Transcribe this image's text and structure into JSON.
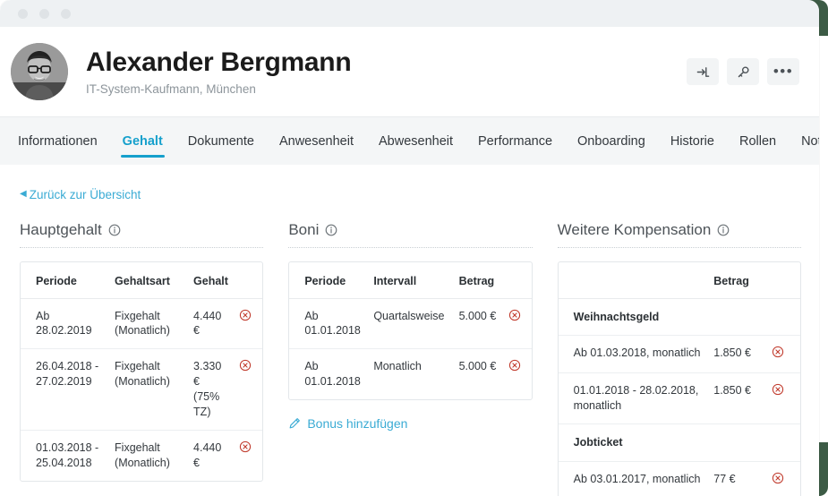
{
  "window": {
    "dots": [
      "dot-1",
      "dot-2",
      "dot-3"
    ]
  },
  "person": {
    "name": "Alexander Bergmann",
    "subtitle": "IT-System-Kaufmann, München",
    "avatar_alt": "avatar-photo"
  },
  "header_actions": [
    {
      "name": "login-as-button",
      "icon": "sign-in-icon"
    },
    {
      "name": "key-button",
      "icon": "key-icon"
    },
    {
      "name": "more-options-button",
      "icon": "ellipsis-icon",
      "label": "•••"
    }
  ],
  "tabs": [
    {
      "label": "Informationen",
      "active": false
    },
    {
      "label": "Gehalt",
      "active": true
    },
    {
      "label": "Dokumente",
      "active": false
    },
    {
      "label": "Anwesenheit",
      "active": false
    },
    {
      "label": "Abwesenheit",
      "active": false
    },
    {
      "label": "Performance",
      "active": false
    },
    {
      "label": "Onboarding",
      "active": false
    },
    {
      "label": "Historie",
      "active": false
    },
    {
      "label": "Rollen",
      "active": false
    },
    {
      "label": "Notizen",
      "active": false
    }
  ],
  "back_link": {
    "caret": "◀",
    "label": "Zurück zur Übersicht"
  },
  "sections": {
    "hauptgehalt": {
      "title": "Hauptgehalt",
      "info_icon": "info-icon",
      "columns": [
        "Periode",
        "Gehaltsart",
        "Gehalt"
      ],
      "rows": [
        {
          "periode": "Ab 28.02.2019",
          "gehaltsart": "Fixgehalt (Monatlich)",
          "gehalt": "4.440 €"
        },
        {
          "periode": "26.04.2018 - 27.02.2019",
          "gehaltsart": "Fixgehalt (Monatlich)",
          "gehalt": "3.330 € (75% TZ)"
        },
        {
          "periode": "01.03.2018 - 25.04.2018",
          "gehaltsart": "Fixgehalt (Monatlich)",
          "gehalt": "4.440 €"
        }
      ]
    },
    "boni": {
      "title": "Boni",
      "info_icon": "info-icon",
      "columns": [
        "Periode",
        "Intervall",
        "Betrag"
      ],
      "rows": [
        {
          "periode": "Ab 01.01.2018",
          "intervall": "Quartalsweise",
          "betrag": "5.000 €"
        },
        {
          "periode": "Ab 01.01.2018",
          "intervall": "Monatlich",
          "betrag": "5.000 €"
        }
      ],
      "add_link": {
        "label": "Bonus hinzufügen",
        "icon": "pencil-icon"
      }
    },
    "weitere_kompensation": {
      "title": "Weitere Kompensation",
      "info_icon": "info-icon",
      "columns": [
        "",
        "Betrag"
      ],
      "rows": [
        {
          "type": "group",
          "label": "Weihnachtsgeld"
        },
        {
          "type": "entry",
          "label": "Ab 01.03.2018, monatlich",
          "betrag": "1.850 €"
        },
        {
          "type": "entry",
          "label": "01.01.2018 - 28.02.2018, monatlich",
          "betrag": "1.850 €"
        },
        {
          "type": "group",
          "label": "Jobticket"
        },
        {
          "type": "entry",
          "label": "Ab 03.01.2017, monatlich",
          "betrag": "77 €"
        }
      ]
    }
  },
  "icons": {
    "delete": "delete-circle-icon"
  },
  "colors": {
    "accent": "#15a0cc",
    "link": "#3aabd4",
    "danger": "#c0392b",
    "titlebar": "#eef1f3",
    "tabbar": "#f4f6f7",
    "deco_green": "#3c5b45"
  }
}
